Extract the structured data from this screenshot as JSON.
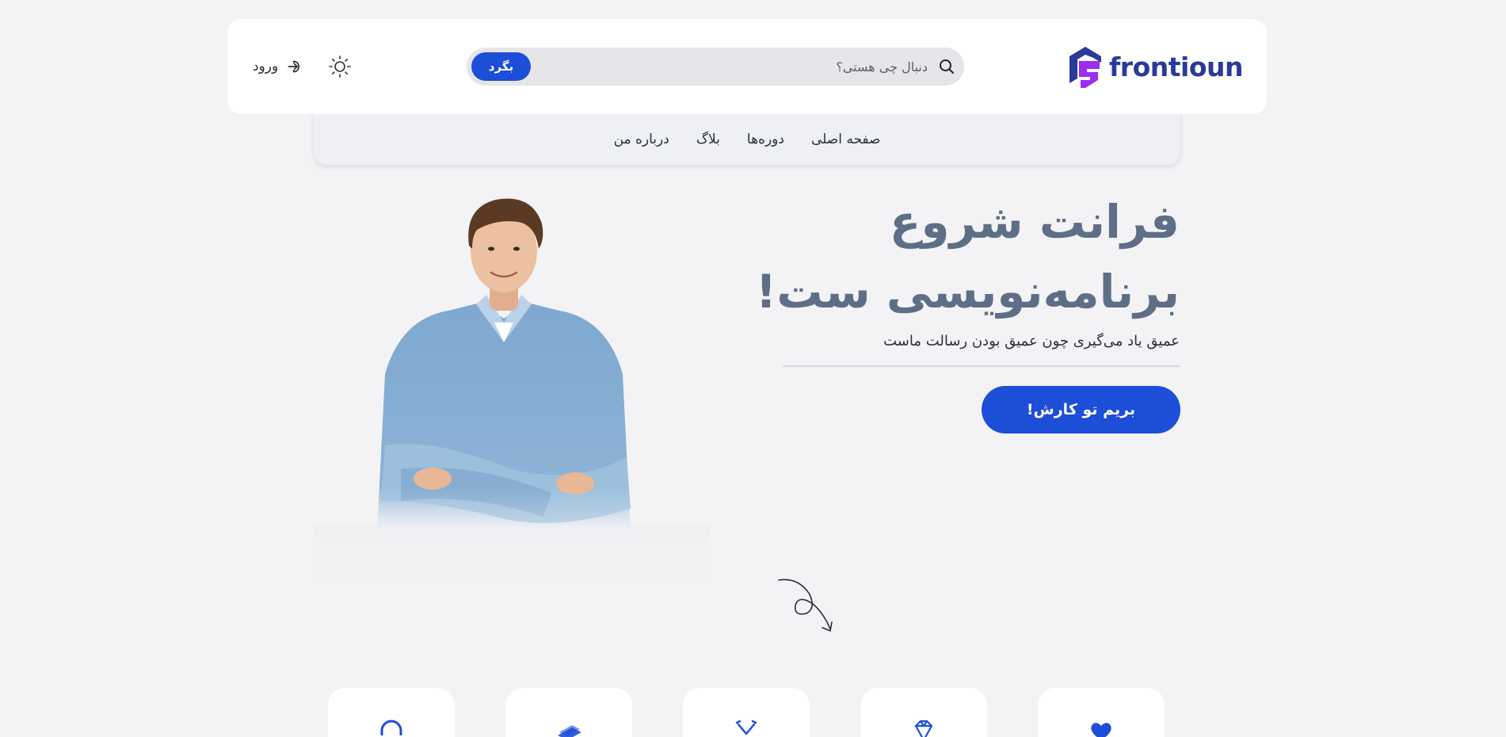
{
  "header": {
    "login_label": "ورود",
    "search": {
      "placeholder": "دنبال چی هستی؟",
      "value": "",
      "button_label": "بگرد"
    },
    "logo_text": "frontioun"
  },
  "nav": {
    "items": [
      {
        "label": "صفحه اصلی"
      },
      {
        "label": "دوره‌ها"
      },
      {
        "label": "بلاگ"
      },
      {
        "label": "درباره من"
      }
    ]
  },
  "hero": {
    "title_line1": "فرانت شروع",
    "title_line2": "برنامه‌نویسی ست!",
    "subtitle": "عمیق یاد می‌گیری چون عمیق بودن رسالت ماست",
    "cta_label": "بریم تو کارش!"
  },
  "feature_cards": [
    {
      "icon": "headset-icon"
    },
    {
      "icon": "money-stack-icon"
    },
    {
      "icon": "tools-icon"
    },
    {
      "icon": "diamond-icon"
    },
    {
      "icon": "heart-icon"
    }
  ],
  "colors": {
    "accent": "#1d4ed8",
    "title": "#5f6e87",
    "logo_text": "#2a3a9a",
    "logo_purple": "#9b2cf0",
    "background": "#f3f3f5"
  }
}
